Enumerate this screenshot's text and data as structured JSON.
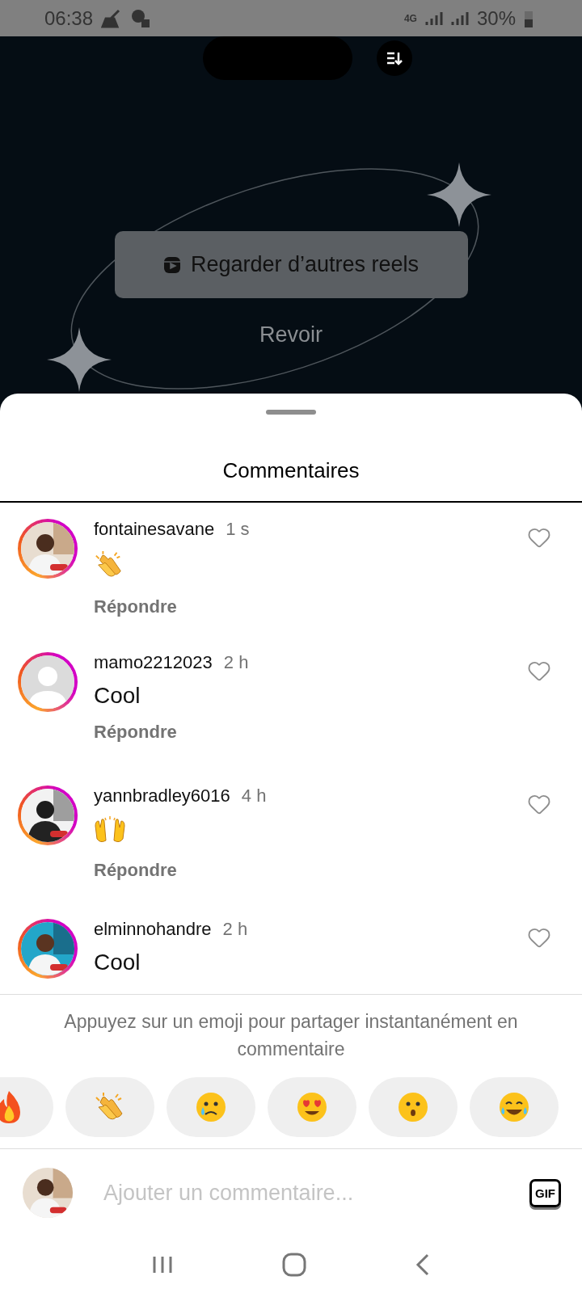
{
  "status_bar": {
    "time": "06:38",
    "network": "4G",
    "battery": "30%"
  },
  "reel_end": {
    "button": "Regarder d’autres reels",
    "replay": "Revoir"
  },
  "sheet": {
    "title": "Commentaires"
  },
  "comments": [
    {
      "username": "fontainesavane",
      "time": "1 s",
      "reaction": {
        "kind": "clap"
      },
      "reply": "Répondre",
      "liked": false
    },
    {
      "username": "mamo2212023",
      "time": "2 h",
      "avatar": {
        "kind": "placeholder"
      },
      "text": "Cool",
      "reply": "Répondre",
      "liked": false
    },
    {
      "username": "yannbradley6016",
      "time": "4 h",
      "reaction": {
        "kind": "raised-hands"
      },
      "reply": "Répondre",
      "liked": false
    },
    {
      "username": "elminnohandre",
      "time": "2 h",
      "text": "Cool",
      "liked": false
    }
  ],
  "emoji_hint": "Appuyez sur un emoji pour partager instantanément en commentaire",
  "emoji_bar": [
    {
      "kind": "fire"
    },
    {
      "kind": "clap"
    },
    {
      "kind": "sad"
    },
    {
      "kind": "heart-eyes"
    },
    {
      "kind": "surprised"
    },
    {
      "kind": "joy"
    }
  ],
  "composer": {
    "placeholder": "Ajouter un commentaire...",
    "gif": "GIF"
  }
}
